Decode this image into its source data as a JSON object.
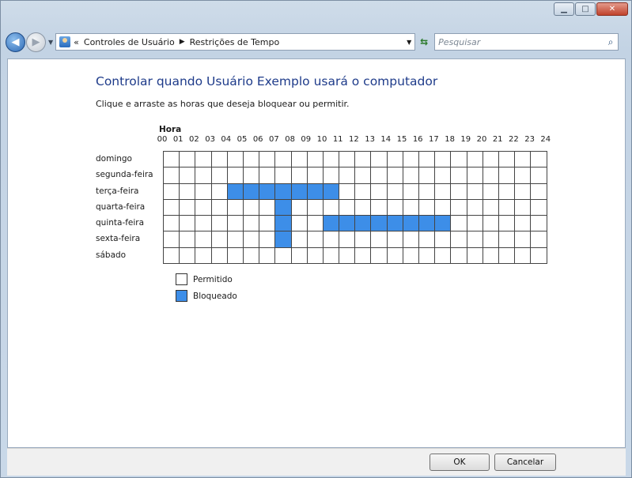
{
  "window": {
    "title_buttons": [
      "minimize",
      "maximize",
      "close"
    ]
  },
  "navigation": {
    "breadcrumb": [
      "Controles de Usuário",
      "Restrições de Tempo"
    ],
    "breadcrumb_prefix": "«",
    "search_placeholder": "Pesquisar"
  },
  "main": {
    "heading": "Controlar quando Usuário Exemplo usará o computador",
    "instruction": "Clique e arraste as horas que deseja bloquear ou permitir.",
    "hour_title": "Hora",
    "hours": [
      "00",
      "01",
      "02",
      "03",
      "04",
      "05",
      "06",
      "07",
      "08",
      "09",
      "10",
      "11",
      "12",
      "13",
      "14",
      "15",
      "16",
      "17",
      "18",
      "19",
      "20",
      "21",
      "22",
      "23",
      "24"
    ],
    "days": [
      "domingo",
      "segunda-feira",
      "terça-feira",
      "quarta-feira",
      "quinta-feira",
      "sexta-feira",
      "sábado"
    ],
    "blocked": {
      "domingo": [],
      "segunda-feira": [],
      "terça-feira": [
        4,
        5,
        6,
        7,
        8,
        9,
        10
      ],
      "quarta-feira": [
        7
      ],
      "quinta-feira": [
        7,
        10,
        11,
        12,
        13,
        14,
        15,
        16,
        17
      ],
      "sexta-feira": [
        7
      ],
      "sábado": []
    },
    "legend": {
      "allowed": "Permitido",
      "blocked": "Bloqueado"
    },
    "colors": {
      "blocked": "#3d8ee8",
      "heading": "#1e3b8a"
    }
  },
  "footer": {
    "ok_label": "OK",
    "cancel_label": "Cancelar"
  }
}
